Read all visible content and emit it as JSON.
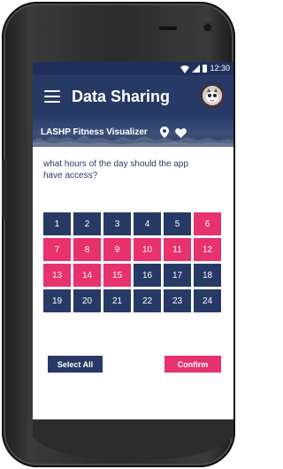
{
  "status_bar": {
    "time": "12:30",
    "icons": [
      "wifi-icon",
      "signal-icon",
      "battery-icon"
    ]
  },
  "app_bar": {
    "title": "Data Sharing",
    "menu_icon": "menu-icon",
    "avatar": "avatar"
  },
  "banner": {
    "label": "LASHP Fitness Visualizer",
    "icons": [
      "location-pin-icon",
      "heart-icon"
    ]
  },
  "question": "what hours of the day should the app have access?",
  "hours": [
    {
      "label": "1",
      "selected": false
    },
    {
      "label": "2",
      "selected": false
    },
    {
      "label": "3",
      "selected": false
    },
    {
      "label": "4",
      "selected": false
    },
    {
      "label": "5",
      "selected": false
    },
    {
      "label": "6",
      "selected": true
    },
    {
      "label": "7",
      "selected": true
    },
    {
      "label": "8",
      "selected": true
    },
    {
      "label": "9",
      "selected": true
    },
    {
      "label": "10",
      "selected": true
    },
    {
      "label": "11",
      "selected": true
    },
    {
      "label": "12",
      "selected": true
    },
    {
      "label": "13",
      "selected": true
    },
    {
      "label": "14",
      "selected": true
    },
    {
      "label": "15",
      "selected": true
    },
    {
      "label": "16",
      "selected": false
    },
    {
      "label": "17",
      "selected": false
    },
    {
      "label": "18",
      "selected": false
    },
    {
      "label": "19",
      "selected": false
    },
    {
      "label": "20",
      "selected": false
    },
    {
      "label": "21",
      "selected": false
    },
    {
      "label": "22",
      "selected": false
    },
    {
      "label": "23",
      "selected": false
    },
    {
      "label": "24",
      "selected": false
    }
  ],
  "buttons": {
    "select_all": "Select All",
    "confirm": "Confirm"
  },
  "colors": {
    "primary": "#273a66",
    "accent": "#e8326d",
    "status_bar": "#20305a"
  }
}
